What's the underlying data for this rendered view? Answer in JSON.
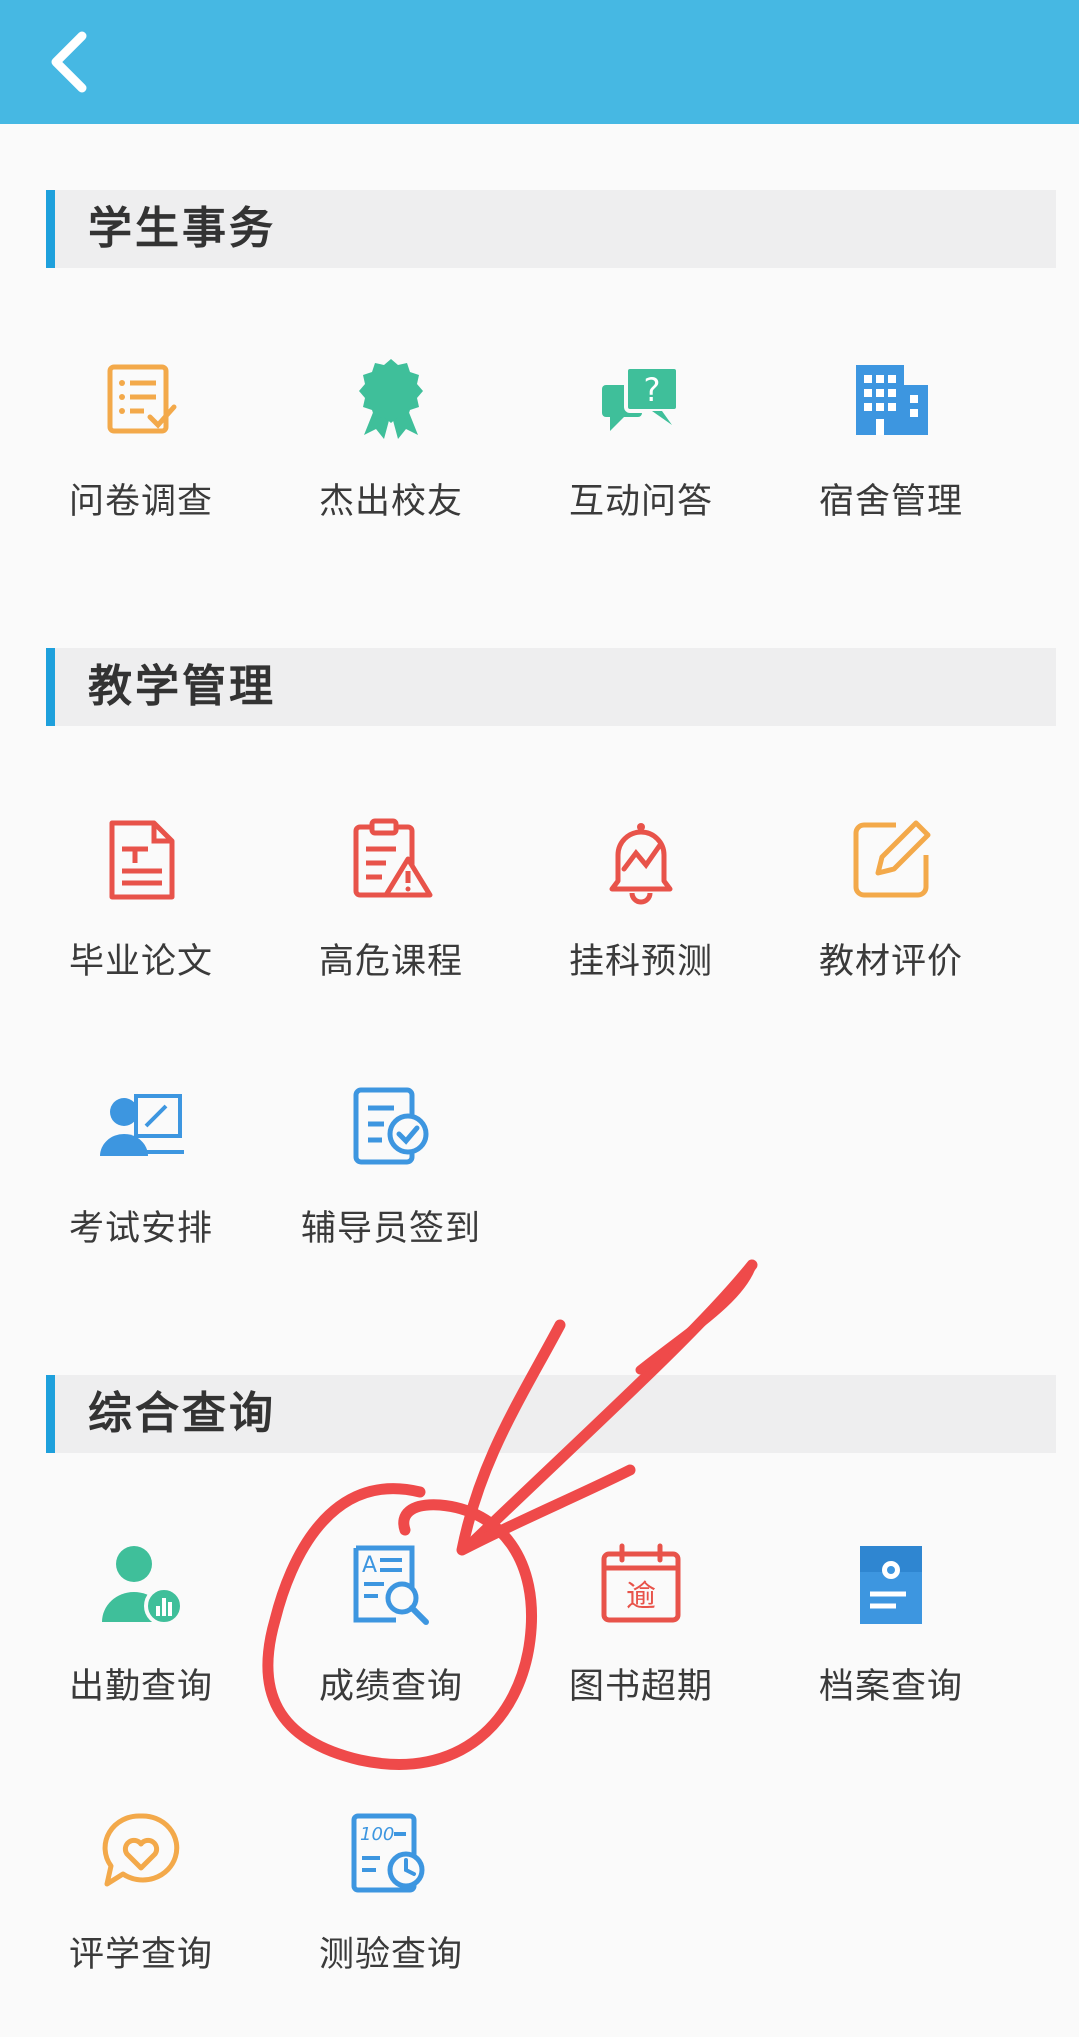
{
  "header": {
    "back_icon": "chevron-left-icon"
  },
  "sections": [
    {
      "title": "学生事务",
      "items": [
        {
          "label": "问卷调查",
          "icon": "survey-icon",
          "color": "#f3a94a"
        },
        {
          "label": "杰出校友",
          "icon": "award-ribbon-icon",
          "color": "#3fbf9a"
        },
        {
          "label": "互动问答",
          "icon": "chat-question-icon",
          "color": "#3fbf9a"
        },
        {
          "label": "宿舍管理",
          "icon": "building-icon",
          "color": "#3d96e0"
        }
      ]
    },
    {
      "title": "教学管理",
      "items": [
        {
          "label": "毕业论文",
          "icon": "thesis-document-icon",
          "color": "#e8534a"
        },
        {
          "label": "高危课程",
          "icon": "clipboard-warning-icon",
          "color": "#e8534a"
        },
        {
          "label": "挂科预测",
          "icon": "bell-alert-icon",
          "color": "#e8534a"
        },
        {
          "label": "教材评价",
          "icon": "edit-square-icon",
          "color": "#f3a94a"
        },
        {
          "label": "考试安排",
          "icon": "teacher-screen-icon",
          "color": "#3d96e0"
        },
        {
          "label": "辅导员签到",
          "icon": "checklist-icon",
          "color": "#3d96e0"
        }
      ]
    },
    {
      "title": "综合查询",
      "items": [
        {
          "label": "出勤查询",
          "icon": "user-stats-icon",
          "color": "#3fbf9a"
        },
        {
          "label": "成绩查询",
          "icon": "grade-search-icon",
          "color": "#3d96e0"
        },
        {
          "label": "图书超期",
          "icon": "calendar-overdue-icon",
          "color": "#e8534a"
        },
        {
          "label": "档案查询",
          "icon": "archive-folder-icon",
          "color": "#3d96e0"
        },
        {
          "label": "评学查询",
          "icon": "heart-chat-icon",
          "color": "#f3a94a"
        },
        {
          "label": "测验查询",
          "icon": "test-score-icon",
          "color": "#3d96e0"
        }
      ]
    }
  ],
  "calendar_glyph": "逾",
  "test_glyph": "100",
  "annotation": {
    "color": "#ef4a4a"
  }
}
